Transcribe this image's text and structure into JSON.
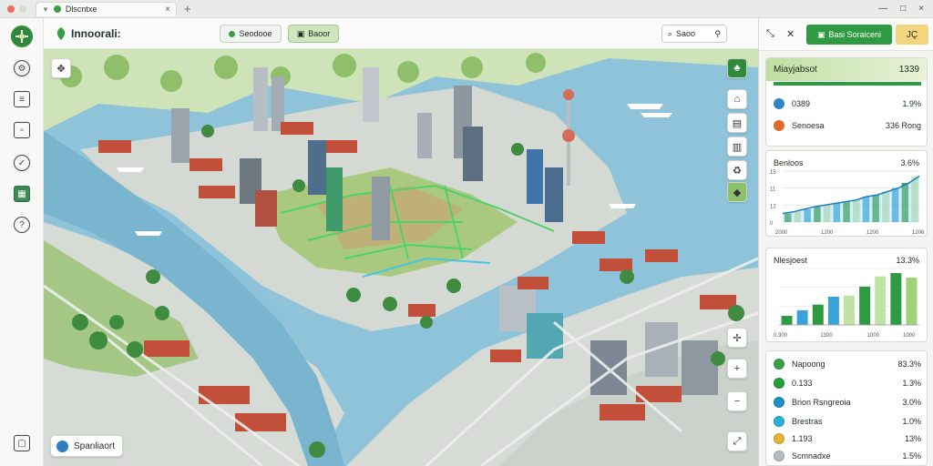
{
  "window": {
    "tab_title": "Dlscntxe",
    "close_glyph": "×",
    "add_tab_glyph": "+",
    "controls": [
      "—",
      "□",
      "×"
    ]
  },
  "toolbar": {
    "app_title": "Innoorali:",
    "button1_label": "Seodooe",
    "button2_label": "Baoor",
    "search_label": "Saoo"
  },
  "map": {
    "chip_label": "Spanliaort"
  },
  "sidebar": {
    "report_button": "Basi Soraiceni",
    "lang_button": "JÇ",
    "summary_card": {
      "title": "Miayjabsot",
      "value": "1339",
      "rows": [
        {
          "label": "0389",
          "value": "1.9%",
          "icon": "compass-icon",
          "color": "#2b86c5"
        },
        {
          "label": "Senoesa",
          "value": "336 Rong",
          "icon": "pin-icon",
          "color": "#e06a2c"
        }
      ]
    },
    "chart1": {
      "title": "Benloos",
      "value": "3.6%"
    },
    "chart2": {
      "title": "Nlesjoest",
      "value": "13.3%"
    },
    "legend_card": {
      "rows": [
        {
          "label": "Napoong",
          "value": "83.3%",
          "icon": "leaf-icon",
          "color": "#3aa046"
        },
        {
          "label": "0.133",
          "value": "1.3%",
          "icon": "circle-icon",
          "color": "#22a13a"
        },
        {
          "label": "Brion Rsngreoia",
          "value": "3.0%",
          "icon": "water-icon",
          "color": "#1f8fc4"
        },
        {
          "label": "Brestras",
          "value": "1.0%",
          "icon": "fish-icon",
          "color": "#2ab0d8"
        },
        {
          "label": "1.193",
          "value": "13%",
          "icon": "coin-icon",
          "color": "#e8b434"
        },
        {
          "label": "Scmnadxe",
          "value": "1.5%",
          "icon": "stone-icon",
          "color": "#b5bcc0"
        }
      ]
    }
  },
  "chart_data": [
    {
      "type": "area",
      "title": "Benloos",
      "subtitle": "3.6%",
      "x": [
        1,
        2,
        3,
        4,
        5,
        6,
        7,
        8,
        9,
        10,
        11,
        12,
        13,
        14
      ],
      "values": [
        1,
        1.2,
        1.5,
        1.8,
        2,
        2.2,
        2.4,
        2.6,
        3,
        3.2,
        3.6,
        4,
        4.6,
        5.4
      ],
      "yticks": [
        "15",
        "11",
        "12",
        "0"
      ],
      "xticks": [
        "2000",
        "1200",
        "1200",
        "1206"
      ],
      "ylim": [
        0,
        6
      ]
    },
    {
      "type": "bar",
      "title": "Nlesjoest",
      "subtitle": "13.3%",
      "categories": [
        "1",
        "2",
        "3",
        "4",
        "5",
        "6",
        "7",
        "8",
        "9"
      ],
      "values": [
        0.8,
        1.3,
        1.8,
        2.5,
        2.6,
        3.4,
        4.3,
        4.6,
        4.2
      ],
      "xticks": [
        "0.300",
        "1300",
        "1000",
        "1000"
      ],
      "ylim": [
        0,
        5
      ]
    }
  ]
}
